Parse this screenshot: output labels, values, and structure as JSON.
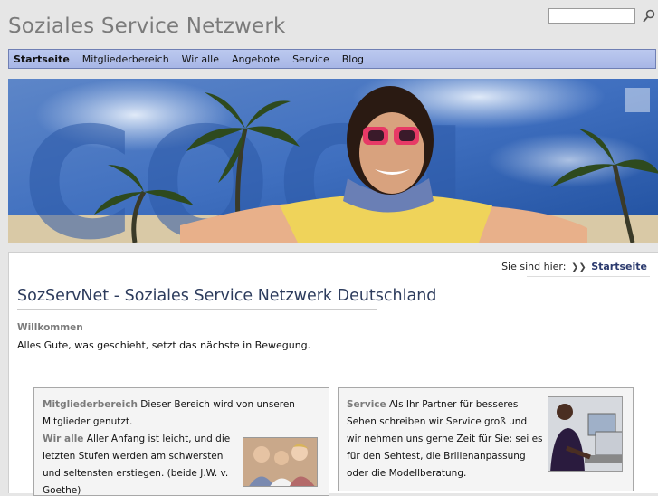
{
  "header": {
    "site_title": "Soziales Service Netzwerk",
    "search_placeholder": ""
  },
  "nav": {
    "items": [
      {
        "label": "Startseite",
        "active": true
      },
      {
        "label": "Mitgliederbereich",
        "active": false
      },
      {
        "label": "Wir alle",
        "active": false
      },
      {
        "label": "Angebote",
        "active": false
      },
      {
        "label": "Service",
        "active": false
      },
      {
        "label": "Blog",
        "active": false
      }
    ]
  },
  "banner": {
    "text": "COOL"
  },
  "breadcrumb": {
    "prefix": "Sie sind hier:",
    "arrow": "❯❯",
    "current": "Startseite"
  },
  "main": {
    "title": "SozServNet - Soziales Service Netzwerk Deutschland",
    "welcome_heading": "Willkommen",
    "welcome_text": "Alles Gute, was geschieht, setzt das nächste in Bewegung."
  },
  "boxes": {
    "members": {
      "p1_keyword": "Mitgliederbereich",
      "p1_text": " Dieser Bereich wird von unseren Mitglieder genutzt.",
      "p2_keyword": "Wir alle",
      "p2_text": " Aller Anfang ist leicht, und die letzten Stufen werden am schwersten und seltensten erstiegen. (beide J.W. v. Goethe)"
    },
    "service": {
      "p1_keyword": "Service",
      "p1_text": " Als Ihr Partner für besseres Sehen schreiben wir Service groß und wir nehmen uns gerne Zeit für Sie: sei es für den Sehtest, die Brillenanpassung oder die Modellberatung."
    }
  },
  "colors": {
    "nav_bg": "#a7b6e6",
    "title": "#2c3b5c",
    "muted": "#7b7b7b"
  }
}
